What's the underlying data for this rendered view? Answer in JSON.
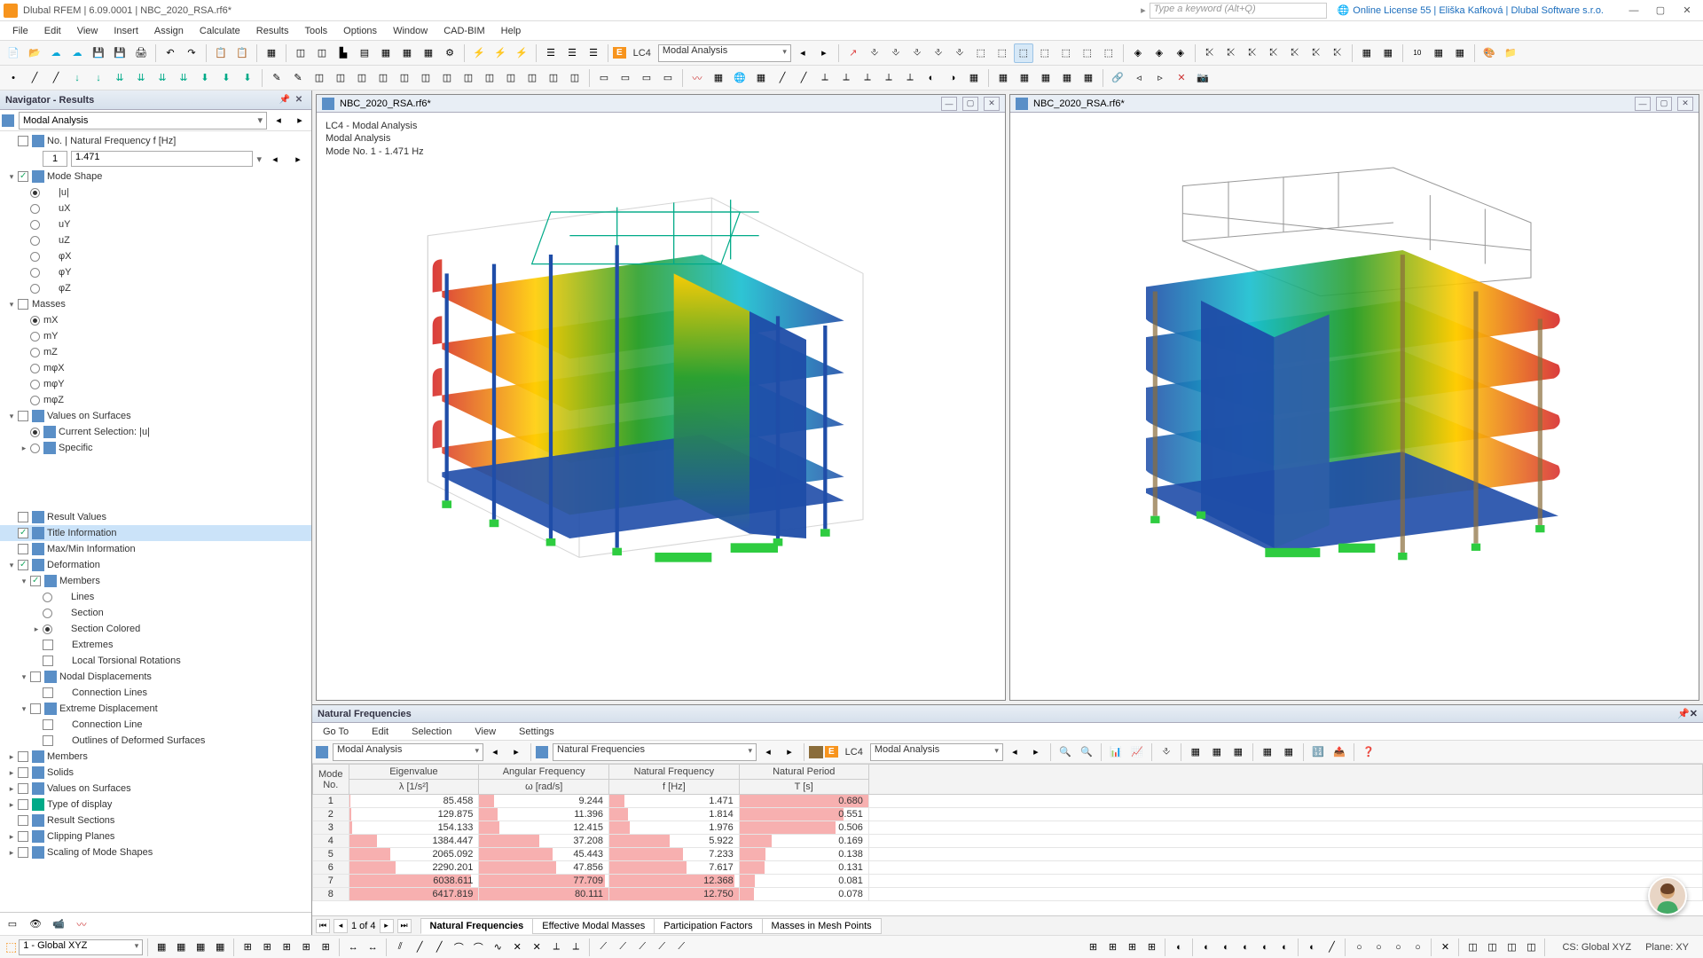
{
  "title": "Dlubal RFEM | 6.09.0001 | NBC_2020_RSA.rf6*",
  "search_placeholder": "Type a keyword (Alt+Q)",
  "license_text": "Online License 55 | Eliška Kafková | Dlubal Software s.r.o.",
  "menu": [
    "File",
    "Edit",
    "View",
    "Insert",
    "Assign",
    "Calculate",
    "Results",
    "Tools",
    "Options",
    "Window",
    "CAD-BIM",
    "Help"
  ],
  "lc_badge": "E",
  "lc_label": "LC4",
  "lc_combo": "Modal Analysis",
  "nav": {
    "header": "Navigator - Results",
    "combo": "Modal Analysis",
    "freq_label": "No. | Natural Frequency f [Hz]",
    "freq_no": "1",
    "freq_val": "1.471",
    "items": {
      "mode_shape": "Mode Shape",
      "u": "|u|",
      "ux": "uX",
      "uy": "uY",
      "uz": "uZ",
      "phx": "φX",
      "phy": "φY",
      "phz": "φZ",
      "masses": "Masses",
      "mx": "mX",
      "my": "mY",
      "mz": "mZ",
      "mphx": "mφX",
      "mphy": "mφY",
      "mphz": "mφZ",
      "values_surfaces": "Values on Surfaces",
      "cur_sel": "Current Selection: |u|",
      "specific": "Specific",
      "result_values": "Result Values",
      "title_info": "Title Information",
      "maxmin": "Max/Min Information",
      "deformation": "Deformation",
      "members": "Members",
      "lines": "Lines",
      "section": "Section",
      "section_colored": "Section Colored",
      "extremes": "Extremes",
      "local_torsion": "Local Torsional Rotations",
      "nodal_disp": "Nodal Displacements",
      "conn_lines": "Connection Lines",
      "extreme_disp": "Extreme Displacement",
      "conn_line": "Connection Line",
      "outlines": "Outlines of Deformed Surfaces",
      "members2": "Members",
      "solids": "Solids",
      "values_surfaces2": "Values on Surfaces",
      "type_display": "Type of display",
      "result_sections": "Result Sections",
      "clipping": "Clipping Planes",
      "scaling": "Scaling of Mode Shapes"
    }
  },
  "viewport_file": "NBC_2020_RSA.rf6*",
  "vp_info": {
    "l1": "LC4 - Modal Analysis",
    "l2": "Modal Analysis",
    "l3": "Mode No. 1 - 1.471 Hz"
  },
  "bottom": {
    "title": "Natural Frequencies",
    "menu": [
      "Go To",
      "Edit",
      "Selection",
      "View",
      "Settings"
    ],
    "combo1": "Modal Analysis",
    "combo2": "Natural Frequencies",
    "lc_label": "LC4",
    "lc_combo": "Modal Analysis",
    "pager": "1 of 4",
    "tabs": [
      "Natural Frequencies",
      "Effective Modal Masses",
      "Participation Factors",
      "Masses in Mesh Points"
    ]
  },
  "chart_data": {
    "type": "table",
    "columns": [
      {
        "h1": "Mode",
        "h2": "No."
      },
      {
        "h1": "Eigenvalue",
        "h2": "λ [1/s²]"
      },
      {
        "h1": "Angular Frequency",
        "h2": "ω [rad/s]"
      },
      {
        "h1": "Natural Frequency",
        "h2": "f [Hz]"
      },
      {
        "h1": "Natural Period",
        "h2": "T [s]"
      }
    ],
    "rows": [
      {
        "no": 1,
        "eigen": 85.458,
        "ang": 9.244,
        "nat": 1.471,
        "per": 0.68
      },
      {
        "no": 2,
        "eigen": 129.875,
        "ang": 11.396,
        "nat": 1.814,
        "per": 0.551
      },
      {
        "no": 3,
        "eigen": 154.133,
        "ang": 12.415,
        "nat": 1.976,
        "per": 0.506
      },
      {
        "no": 4,
        "eigen": 1384.447,
        "ang": 37.208,
        "nat": 5.922,
        "per": 0.169
      },
      {
        "no": 5,
        "eigen": 2065.092,
        "ang": 45.443,
        "nat": 7.233,
        "per": 0.138
      },
      {
        "no": 6,
        "eigen": 2290.201,
        "ang": 47.856,
        "nat": 7.617,
        "per": 0.131
      },
      {
        "no": 7,
        "eigen": 6038.611,
        "ang": 77.709,
        "nat": 12.368,
        "per": 0.081
      },
      {
        "no": 8,
        "eigen": 6417.819,
        "ang": 80.111,
        "nat": 12.75,
        "per": 0.078
      }
    ]
  },
  "status": {
    "coord": "1 - Global XYZ",
    "cs": "CS: Global XYZ",
    "plane": "Plane: XY"
  }
}
